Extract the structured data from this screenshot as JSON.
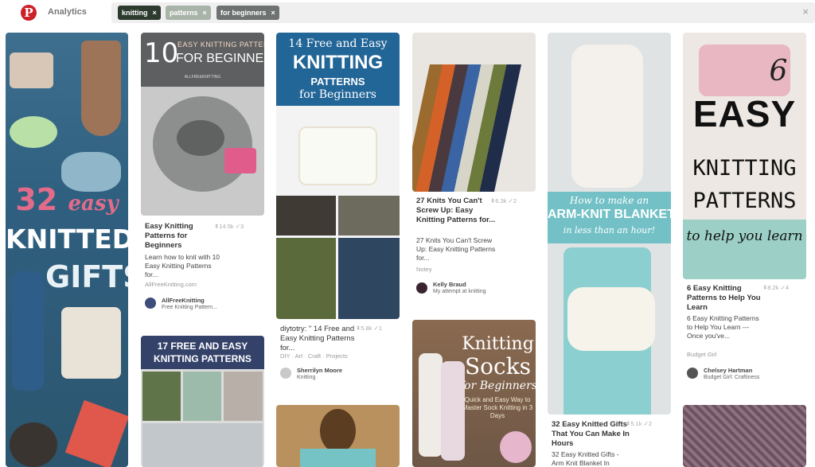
{
  "header": {
    "logo_letter": "P",
    "title": "Analytics",
    "chips": [
      {
        "label": "knitting",
        "color": "#2d3b2f"
      },
      {
        "label": "patterns",
        "color": "#a9b4a9"
      },
      {
        "label": "for beginners",
        "color": "#6e7270"
      }
    ],
    "chip_close": "×",
    "clear": "×"
  },
  "pins": {
    "p1": {
      "img_text_a": "32",
      "img_text_b": "easy",
      "img_text_c": "KNITTED",
      "img_text_d": "GIFTS"
    },
    "p2": {
      "img_text_a": "10",
      "img_text_b": "EASY KNITTING PATTERNS",
      "img_text_c": "FOR BEGINNERS",
      "img_text_d": "ALLFREEKNITTING",
      "title": "Easy Knitting Patterns for Beginners",
      "repins": "14.5k",
      "likes": "3",
      "desc": "Learn how to knit with 10 Easy Knitting Patterns for...",
      "source": "AllFreeKnitting.com",
      "user": "AllFreeKnitting",
      "board": "Free Knitting Pattern..."
    },
    "p3": {
      "img_text_a": "17 FREE AND EASY",
      "img_text_b": "KNITTING PATTERNS"
    },
    "p4": {
      "img_text_a": "14 Free and Easy",
      "img_text_b": "KNITTING",
      "img_text_c": "PATTERNS",
      "img_text_d": "for Beginners",
      "title": "diytotry: \" 14 Free and Easy Knitting Patterns for...",
      "repins": "5.8k",
      "likes": "1",
      "source": "DIY · Art · Craft · Projects",
      "user": "Sherrilyn Moore",
      "board": "Knitting"
    },
    "p5": {
      "title": "27 Knits You Can't Screw Up: Easy Knitting Patterns for...",
      "repins": "6.3k",
      "likes": "2",
      "desc": "27 Knits You Can't Screw Up: Easy Knitting Patterns for...",
      "source": "Notey",
      "user": "Kelly Braud",
      "board": "My attempt at knitting"
    },
    "p6": {
      "img_text_a": "Knitting",
      "img_text_b": "Socks",
      "img_text_c": "for Beginners",
      "img_text_d": "Quick and Easy Way to Master Sock Knitting in 3 Days"
    },
    "p7": {
      "img_text_a": "How to make an",
      "img_text_b": "ARM-KNIT BLANKET",
      "img_text_c": "in less than an hour!",
      "title": "32 Easy Knitted Gifts That You Can Make In Hours",
      "repins": "5.1k",
      "likes": "2",
      "desc": "32 Easy Knitted Gifts - Arm Knit Blanket In"
    },
    "p8": {
      "img_text_a": "6",
      "img_text_b": "EASY",
      "img_text_c": "KNITTING",
      "img_text_d": "PATTERNS",
      "img_text_e": "to help you learn",
      "title": "6 Easy Knitting Patterns to Help You Learn",
      "repins": "8.2k",
      "likes": "4",
      "desc": "6 Easy Knitting Patterns to Help You Learn --- Once you've...",
      "source": "Budget Girl",
      "user": "Chelsey Hartman",
      "board": "Budget Girl: Craftiness"
    }
  },
  "icons": {
    "pin": "⇞",
    "check": "✓"
  }
}
